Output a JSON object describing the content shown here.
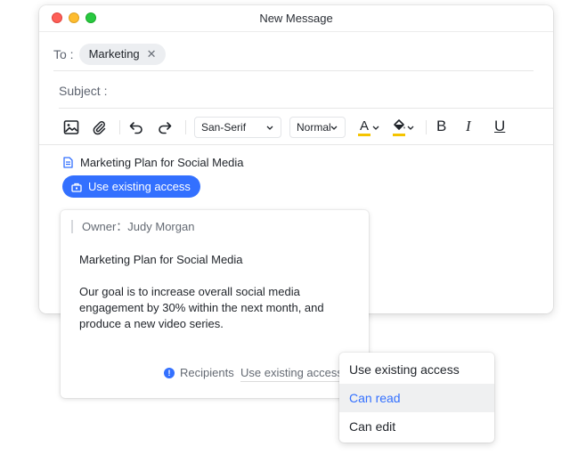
{
  "window": {
    "title": "New Message"
  },
  "to": {
    "label": "To :",
    "recipients": [
      {
        "name": "Marketing"
      }
    ]
  },
  "subject": {
    "label": "Subject :"
  },
  "toolbar": {
    "font_family": "San-Serif",
    "font_size": "Normal",
    "font_color_glyph": "A",
    "bold_glyph": "B",
    "italic_glyph": "I",
    "underline_glyph": "U",
    "icons": [
      "image-icon",
      "attachment-icon",
      "undo-icon",
      "redo-icon",
      "font-color-icon",
      "highlight-icon",
      "bold-icon",
      "italic-icon",
      "underline-icon"
    ]
  },
  "document": {
    "title": "Marketing Plan for Social Media",
    "access_button": "Use existing access"
  },
  "card": {
    "owner": "Owner：Judy Morgan",
    "title": "Marketing Plan for Social Media",
    "description": "Our goal is to increase overall social media engagement by 30% within the next month, and produce a new video series.",
    "recipients_label": "Recipients",
    "permission_value": "Use existing access"
  },
  "permission_menu": {
    "items": [
      {
        "label": "Use existing access"
      },
      {
        "label": "Can read"
      },
      {
        "label": "Can edit"
      }
    ],
    "highlighted": "Can read"
  },
  "colors": {
    "accent": "#3370ff",
    "font_color_underline": "#f5c400",
    "highlight_underline": "#f5c400"
  }
}
